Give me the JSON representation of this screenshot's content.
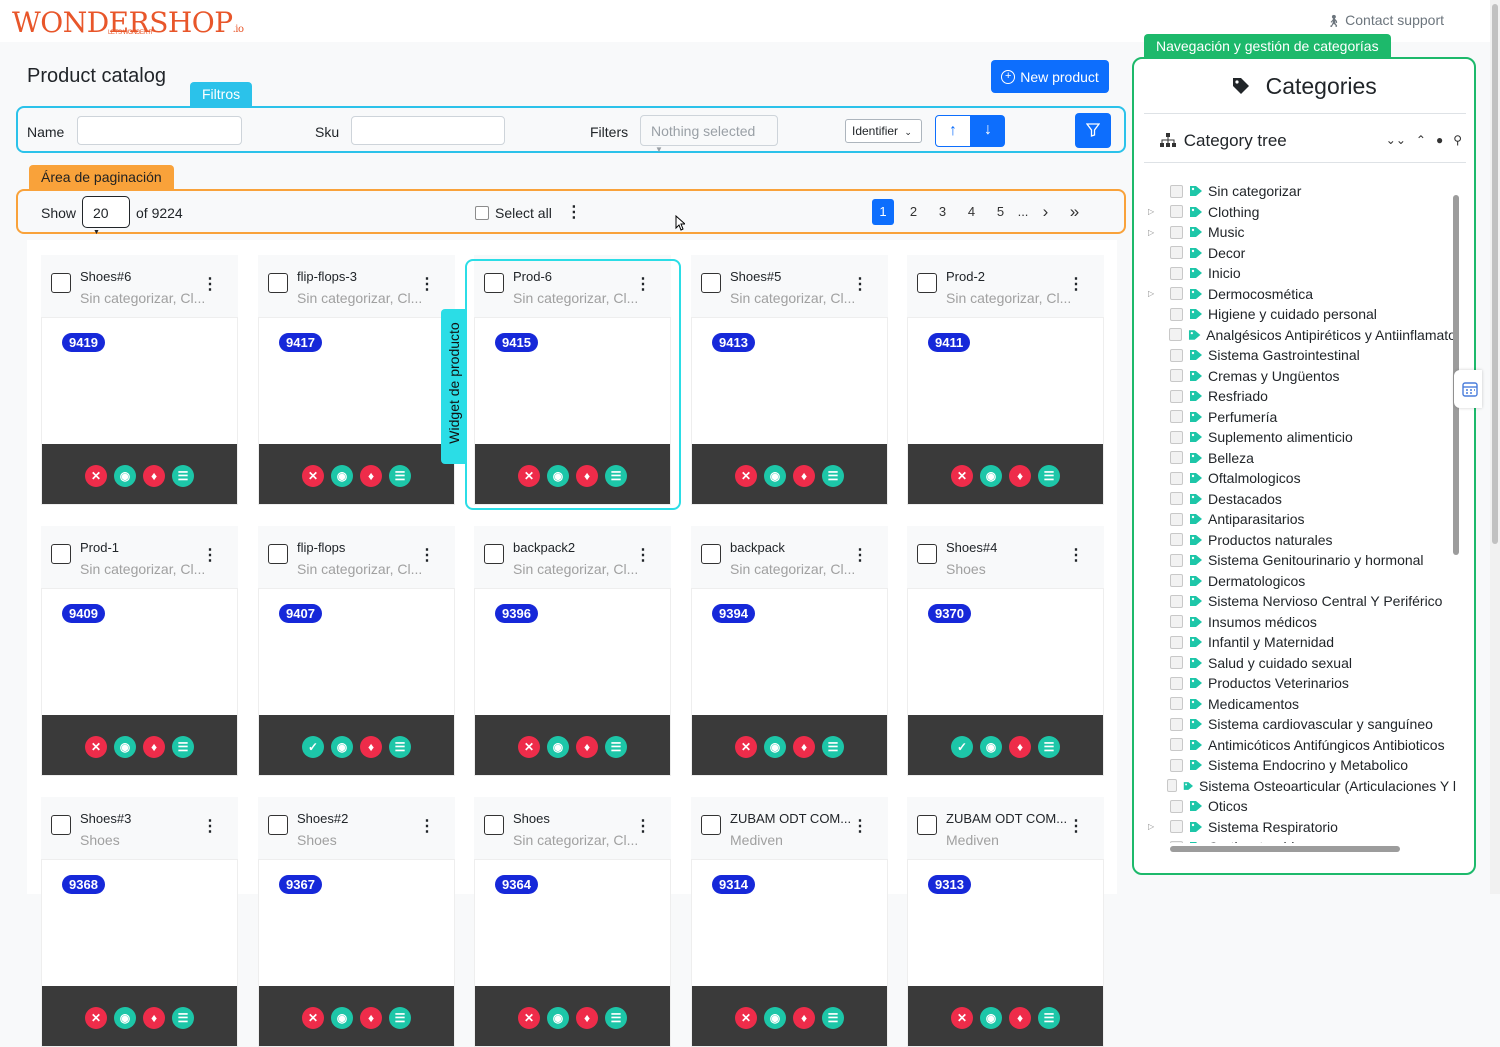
{
  "brand": {
    "logo_main": "WONDERSHOP",
    "logo_suffix": ".io",
    "logo_tagline": "LET'S WONDER IT"
  },
  "header": {
    "contact": "Contact support"
  },
  "page": {
    "title": "Product catalog",
    "new_product": "New product"
  },
  "annotations": {
    "filters": "Filtros",
    "pagination": "Área de paginación",
    "widget": "Widget de producto",
    "categories": "Navegación y gestión de categorías"
  },
  "filters": {
    "name_label": "Name",
    "name_value": "",
    "sku_label": "Sku",
    "sku_value": "",
    "filters_label": "Filters",
    "filters_select": "Nothing selected",
    "sort_field": "Identifier"
  },
  "pagination": {
    "show_label": "Show",
    "per_page": "20",
    "of_total": "of 9224",
    "select_all": "Select all",
    "pages": [
      "1",
      "2",
      "3",
      "4",
      "5"
    ],
    "ellipsis": "...",
    "next": "›",
    "last": "»",
    "current": "1"
  },
  "products": [
    {
      "name": "Shoes#6",
      "category": "Sin categorizar, Cl...",
      "id": "9419",
      "status": "red"
    },
    {
      "name": "flip-flops-3",
      "category": "Sin categorizar, Cl...",
      "id": "9417",
      "status": "red"
    },
    {
      "name": "Prod-6",
      "category": "Sin categorizar, Cl...",
      "id": "9415",
      "status": "red"
    },
    {
      "name": "Shoes#5",
      "category": "Sin categorizar, Cl...",
      "id": "9413",
      "status": "red"
    },
    {
      "name": "Prod-2",
      "category": "Sin categorizar, Cl...",
      "id": "9411",
      "status": "red"
    },
    {
      "name": "Prod-1",
      "category": "Sin categorizar, Cl...",
      "id": "9409",
      "status": "red"
    },
    {
      "name": "flip-flops",
      "category": "Sin categorizar, Cl...",
      "id": "9407",
      "status": "teal"
    },
    {
      "name": "backpack2",
      "category": "Sin categorizar, Cl...",
      "id": "9396",
      "status": "red"
    },
    {
      "name": "backpack",
      "category": "Sin categorizar, Cl...",
      "id": "9394",
      "status": "red"
    },
    {
      "name": "Shoes#4",
      "category": "Shoes",
      "id": "9370",
      "status": "teal"
    },
    {
      "name": "Shoes#3",
      "category": "Shoes",
      "id": "9368",
      "status": "red"
    },
    {
      "name": "Shoes#2",
      "category": "Shoes",
      "id": "9367",
      "status": "red"
    },
    {
      "name": "Shoes",
      "category": "Sin categorizar, Cl...",
      "id": "9364",
      "status": "red"
    },
    {
      "name": "ZUBAM ODT COM...",
      "category": "Mediven",
      "id": "9314",
      "status": "red"
    },
    {
      "name": "ZUBAM ODT COM...",
      "category": "Mediven",
      "id": "9313",
      "status": "red"
    }
  ],
  "categories": {
    "title": "Categories",
    "tree_title": "Category tree",
    "items": [
      {
        "label": "Sin categorizar",
        "expandable": false
      },
      {
        "label": "Clothing",
        "expandable": true
      },
      {
        "label": "Music",
        "expandable": true
      },
      {
        "label": "Decor",
        "expandable": false
      },
      {
        "label": "Inicio",
        "expandable": false
      },
      {
        "label": "Dermocosmética",
        "expandable": true
      },
      {
        "label": "Higiene y cuidado personal",
        "expandable": false
      },
      {
        "label": "Analgésicos Antipiréticos y Antiinflamato",
        "expandable": false
      },
      {
        "label": "Sistema Gastrointestinal",
        "expandable": false
      },
      {
        "label": "Cremas y Ungüentos",
        "expandable": false
      },
      {
        "label": "Resfriado",
        "expandable": false
      },
      {
        "label": "Perfumería",
        "expandable": false
      },
      {
        "label": "Suplemento alimenticio",
        "expandable": false
      },
      {
        "label": "Belleza",
        "expandable": false
      },
      {
        "label": "Oftalmologicos",
        "expandable": false
      },
      {
        "label": "Destacados",
        "expandable": false
      },
      {
        "label": "Antiparasitarios",
        "expandable": false
      },
      {
        "label": "Productos naturales",
        "expandable": false
      },
      {
        "label": "Sistema Genitourinario y hormonal",
        "expandable": false
      },
      {
        "label": "Dermatologicos",
        "expandable": false
      },
      {
        "label": "Sistema Nervioso Central Y Periférico",
        "expandable": false
      },
      {
        "label": "Insumos médicos",
        "expandable": false
      },
      {
        "label": "Infantil y Maternidad",
        "expandable": false
      },
      {
        "label": "Salud y cuidado sexual",
        "expandable": false
      },
      {
        "label": "Productos Veterinarios",
        "expandable": false
      },
      {
        "label": "Medicamentos",
        "expandable": false
      },
      {
        "label": "Sistema cardiovascular y sanguíneo",
        "expandable": false
      },
      {
        "label": "Antimicóticos Antifúngicos Antibioticos",
        "expandable": false
      },
      {
        "label": "Sistema Endocrino y Metabolico",
        "expandable": false
      },
      {
        "label": "Sistema Osteoarticular (Articulaciones Y l",
        "expandable": false
      },
      {
        "label": "Oticos",
        "expandable": false
      },
      {
        "label": "Sistema Respiratorio",
        "expandable": true
      },
      {
        "label": "Corticosteroides",
        "expandable": false
      }
    ]
  },
  "colors": {
    "primary": "#0d6efd",
    "filters_outline": "#2bc2ea",
    "pagination_outline": "#f9a23a",
    "categories_outline": "#1db96b",
    "widget_outline": "#2bdde6",
    "id_badge": "#1628d9",
    "action_red": "#ee2c4a",
    "action_teal": "#1dc6a8",
    "category_icon": "#1dc6a8"
  }
}
